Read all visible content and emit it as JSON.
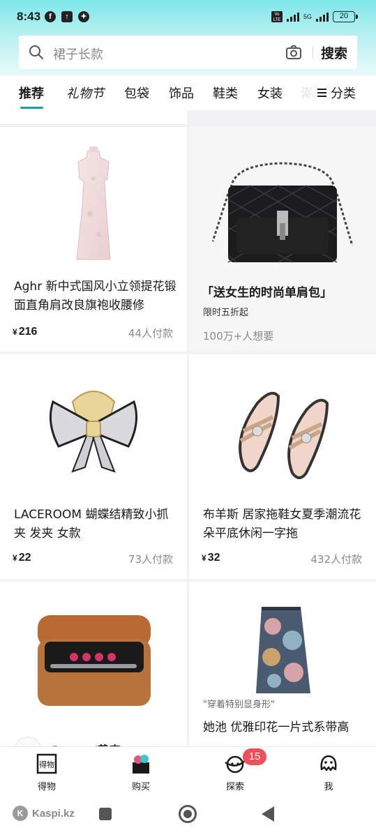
{
  "status": {
    "time": "8:43",
    "battery": "20",
    "volte": "Vo LTE",
    "net": "5G"
  },
  "search": {
    "placeholder": "裙子长款",
    "button": "搜索"
  },
  "tabs": [
    {
      "label": "推荐",
      "active": true
    },
    {
      "label": "礼物节"
    },
    {
      "label": "包袋"
    },
    {
      "label": "饰品"
    },
    {
      "label": "鞋类"
    },
    {
      "label": "女装"
    },
    {
      "label": "潮"
    }
  ],
  "category_button": "分类",
  "products": [
    {
      "title": "Aghr 新中式国风小立领提花锻面直角肩改良旗袍收腰修",
      "currency": "¥",
      "price": "216",
      "paid": "44人付款",
      "image": "qipao-dress"
    },
    {
      "promo_title": "「送女生的时尚单肩包」",
      "promo_sub": "限时五折起",
      "promo_want": "100万+人想要",
      "image": "black-quilted-shoulder-bag"
    },
    {
      "title": "LACEROOM 蝴蝶结精致小抓夹 发夹 女款",
      "currency": "¥",
      "price": "22",
      "paid": "73人付款",
      "image": "bow-hair-claw"
    },
    {
      "title": "布羊斯 居家拖鞋女夏季潮流花朵平底休闲一字拖",
      "currency": "¥",
      "price": "32",
      "paid": "432人付款",
      "image": "flower-slippers"
    },
    {
      "brand_peek": "Dyson/戴森",
      "image": "dyson-airwrap-box"
    },
    {
      "quote": "\"穿着特别显身形\"",
      "title": "她池 优雅印花一片式系带高",
      "image": "printed-wrap-skirt"
    }
  ],
  "bottom_nav": [
    {
      "label": "得物",
      "icon": "dewu-logo-icon"
    },
    {
      "label": "购买",
      "icon": "shopping-box-icon"
    },
    {
      "label": "探索",
      "icon": "planet-icon",
      "badge": "15"
    },
    {
      "label": "我",
      "icon": "profile-face-icon"
    }
  ],
  "system_bar": {
    "app": "Kaspi.kz"
  },
  "colors": {
    "accent": "#15a3a8",
    "badge": "#f24d5a",
    "header_gradient_top": "#7ee6ea"
  }
}
